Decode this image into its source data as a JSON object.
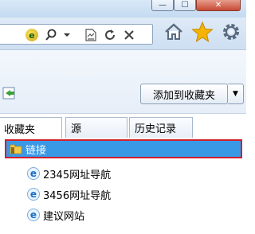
{
  "window": {
    "min_glyph": "—",
    "max_glyph": "☐",
    "close_glyph": "✕"
  },
  "toolbar": {
    "address_icons": [
      "ie-logo-icon",
      "search-icon",
      "dropdown-icon",
      "compatibility-icon",
      "refresh-icon",
      "stop-icon"
    ],
    "home_glyph": "⌂",
    "favorites_glyph": "★",
    "tools_glyph": "⚙"
  },
  "favorites_pane": {
    "add_button_label": "添加到收藏夹",
    "tabs": [
      {
        "label": "收藏夹",
        "active": true
      },
      {
        "label": "源",
        "active": false
      },
      {
        "label": "历史记录",
        "active": false
      }
    ],
    "items": [
      {
        "label": "链接",
        "type": "folder",
        "selected": true
      },
      {
        "label": "2345网址导航",
        "type": "link"
      },
      {
        "label": "3456网址导航",
        "type": "link"
      },
      {
        "label": "建议网站",
        "type": "link"
      }
    ]
  },
  "colors": {
    "selection": "#3a99e6",
    "highlight_border": "#d21f2b",
    "star": "#f4b400"
  }
}
